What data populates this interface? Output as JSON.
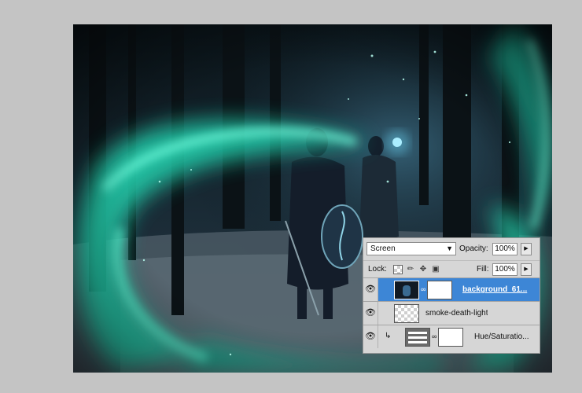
{
  "layers_panel": {
    "blend_mode": "Screen",
    "opacity_label": "Opacity:",
    "opacity_value": "100%",
    "lock_label": "Lock:",
    "fill_label": "Fill:",
    "fill_value": "100%",
    "layers": [
      {
        "name": "background_61...",
        "selected": true,
        "visible": true,
        "thumb": "image-with-mask"
      },
      {
        "name": "smoke-death-light",
        "selected": false,
        "visible": true,
        "thumb": "transparent"
      },
      {
        "name": "Hue/Saturatio...",
        "selected": false,
        "visible": true,
        "thumb": "adjustment-with-mask",
        "clipped": true
      }
    ]
  },
  "icons": {
    "eye": "eye-icon",
    "chain": "link-icon",
    "dropdown": "chevron-down-icon",
    "flyout": "triangle-right-icon",
    "lock_transparent": "checker-lock-icon",
    "lock_pixels": "brush-icon",
    "lock_position": "move-arrows-icon",
    "lock_all": "padlock-icon",
    "clip": "clip-arrow-icon"
  },
  "colors": {
    "app_bg": "#c4c4c4",
    "panel_bg": "#d6d6d6",
    "selection": "#3d86d6",
    "glow": "#2fd9b8"
  }
}
